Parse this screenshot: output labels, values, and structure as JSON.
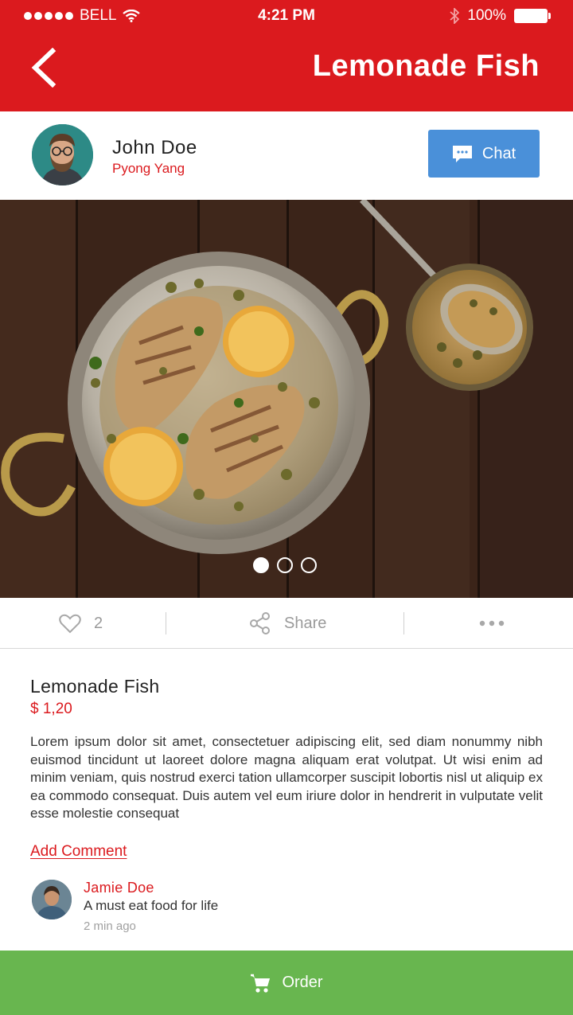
{
  "status_bar": {
    "carrier": "BELL",
    "time": "4:21 PM",
    "battery": "100%"
  },
  "header": {
    "title": "Lemonade Fish"
  },
  "profile": {
    "name": "John Doe",
    "location": "Pyong Yang",
    "chat_label": "Chat"
  },
  "gallery": {
    "page_count": 3,
    "active_page": 1
  },
  "actions": {
    "like_count": "2",
    "share_label": "Share"
  },
  "product": {
    "name": "Lemonade Fish",
    "price": "$ 1,20",
    "description": "Lorem ipsum dolor sit amet, consectetuer adipiscing elit, sed diam nonummy nibh euismod tincidunt ut laoreet dolore magna aliquam erat volutpat. Ut wisi enim ad minim veniam, quis nostrud exerci tation ullamcorper suscipit lobortis nisl ut aliquip ex ea commodo consequat. Duis autem vel eum iriure dolor in hendrerit in vulputate velit esse molestie consequat"
  },
  "comments": {
    "add_label": "Add Comment",
    "items": [
      {
        "author": "Jamie Doe",
        "text": "A must eat food for life",
        "time": "2 min ago"
      }
    ]
  },
  "order": {
    "label": "Order"
  },
  "colors": {
    "brand_red": "#db1a1e",
    "chat_blue": "#4a90d9",
    "order_green": "#68b64f"
  }
}
